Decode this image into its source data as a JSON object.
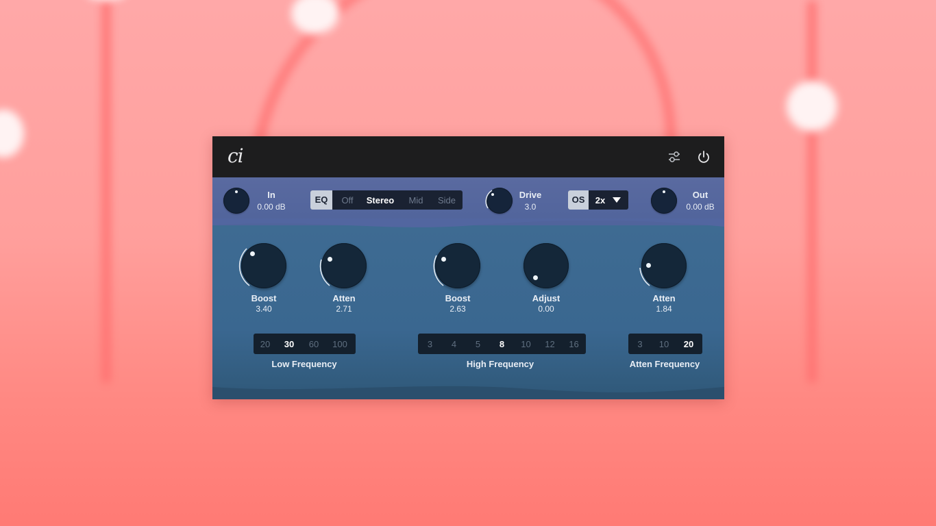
{
  "app": {
    "logo": "ci"
  },
  "titlebar": {
    "settings_icon": "sliders-icon",
    "power_icon": "power-icon"
  },
  "top": {
    "in": {
      "label": "In",
      "value": "0.00 dB"
    },
    "mode": {
      "eq": "EQ",
      "options": [
        "Off",
        "Stereo",
        "Mid",
        "Side"
      ],
      "selected": "Stereo"
    },
    "drive": {
      "label": "Drive",
      "value": "3.0"
    },
    "os": {
      "label": "OS",
      "value": "2x"
    },
    "out": {
      "label": "Out",
      "value": "0.00 dB"
    }
  },
  "low": {
    "boost": {
      "label": "Boost",
      "value": "3.40"
    },
    "atten": {
      "label": "Atten",
      "value": "2.71"
    },
    "freq": {
      "options": [
        "20",
        "30",
        "60",
        "100"
      ],
      "selected": "30",
      "label": "Low Frequency"
    }
  },
  "high": {
    "boost": {
      "label": "Boost",
      "value": "2.63"
    },
    "adjust": {
      "label": "Adjust",
      "value": "0.00"
    },
    "freq": {
      "options": [
        "3",
        "4",
        "5",
        "8",
        "10",
        "12",
        "16"
      ],
      "selected": "8",
      "label": "High Frequency"
    }
  },
  "atten_section": {
    "atten": {
      "label": "Atten",
      "value": "1.84"
    },
    "freq": {
      "options": [
        "3",
        "10",
        "20"
      ],
      "selected": "20",
      "label": "Atten Frequency"
    }
  },
  "colors": {
    "background": "#ff9f9c",
    "panel_top": "#55679e",
    "panel_main": "#3c6991",
    "knob": "#142739"
  }
}
